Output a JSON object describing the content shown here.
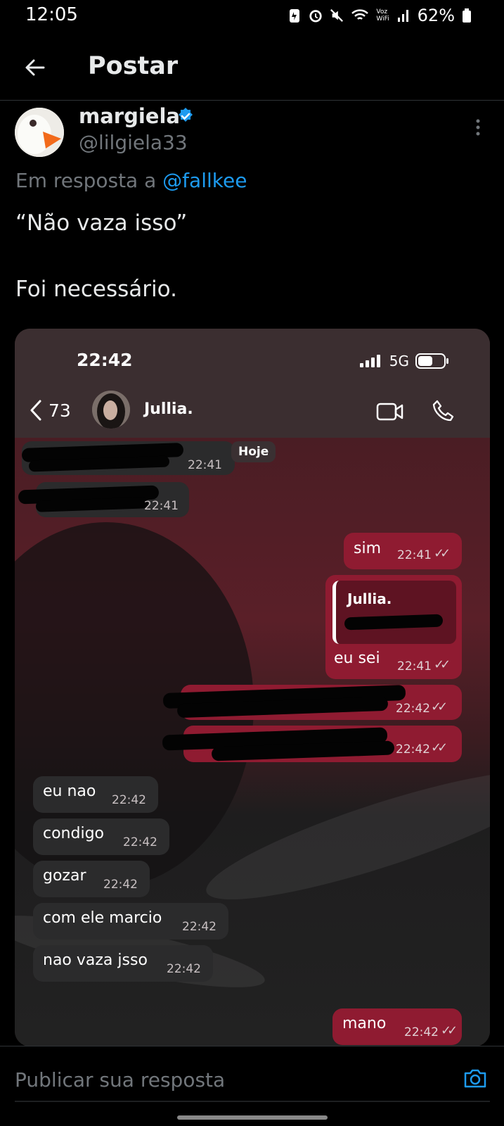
{
  "status_bar": {
    "time": "12:05",
    "voz_label": "Voz",
    "wifi_label": "WiFi",
    "battery": "62%"
  },
  "header": {
    "title": "Postar"
  },
  "tweet": {
    "author_name": "margiela",
    "author_handle": "@lilgiela33",
    "reply_prefix": "Em resposta a ",
    "reply_handle": "@fallkee",
    "text": "“Não vaza isso”\n\nFoi necessário."
  },
  "chat": {
    "time": "22:42",
    "network": "5G",
    "back_count": "73",
    "contact_name": "Jullia.",
    "date_chip": "Hoje",
    "quote_name": "Jullia.",
    "messages": [
      {
        "text": "",
        "time": "22:41"
      },
      {
        "text": "",
        "time": "22:41"
      },
      {
        "text": "sim",
        "time": "22:41"
      },
      {
        "text": "eu sei",
        "time": "22:41"
      },
      {
        "text": "",
        "time": "22:42"
      },
      {
        "text": "",
        "time": "22:42"
      },
      {
        "text": "eu nao",
        "time": "22:42"
      },
      {
        "text": "condigo",
        "time": "22:42"
      },
      {
        "text": "gozar",
        "time": "22:42"
      },
      {
        "text": "com ele marcio",
        "time": "22:42"
      },
      {
        "text": "nao vaza jsso",
        "time": "22:42"
      },
      {
        "text": "mano",
        "time": "22:42"
      }
    ]
  },
  "reply_box": {
    "placeholder": "Publicar sua resposta"
  }
}
